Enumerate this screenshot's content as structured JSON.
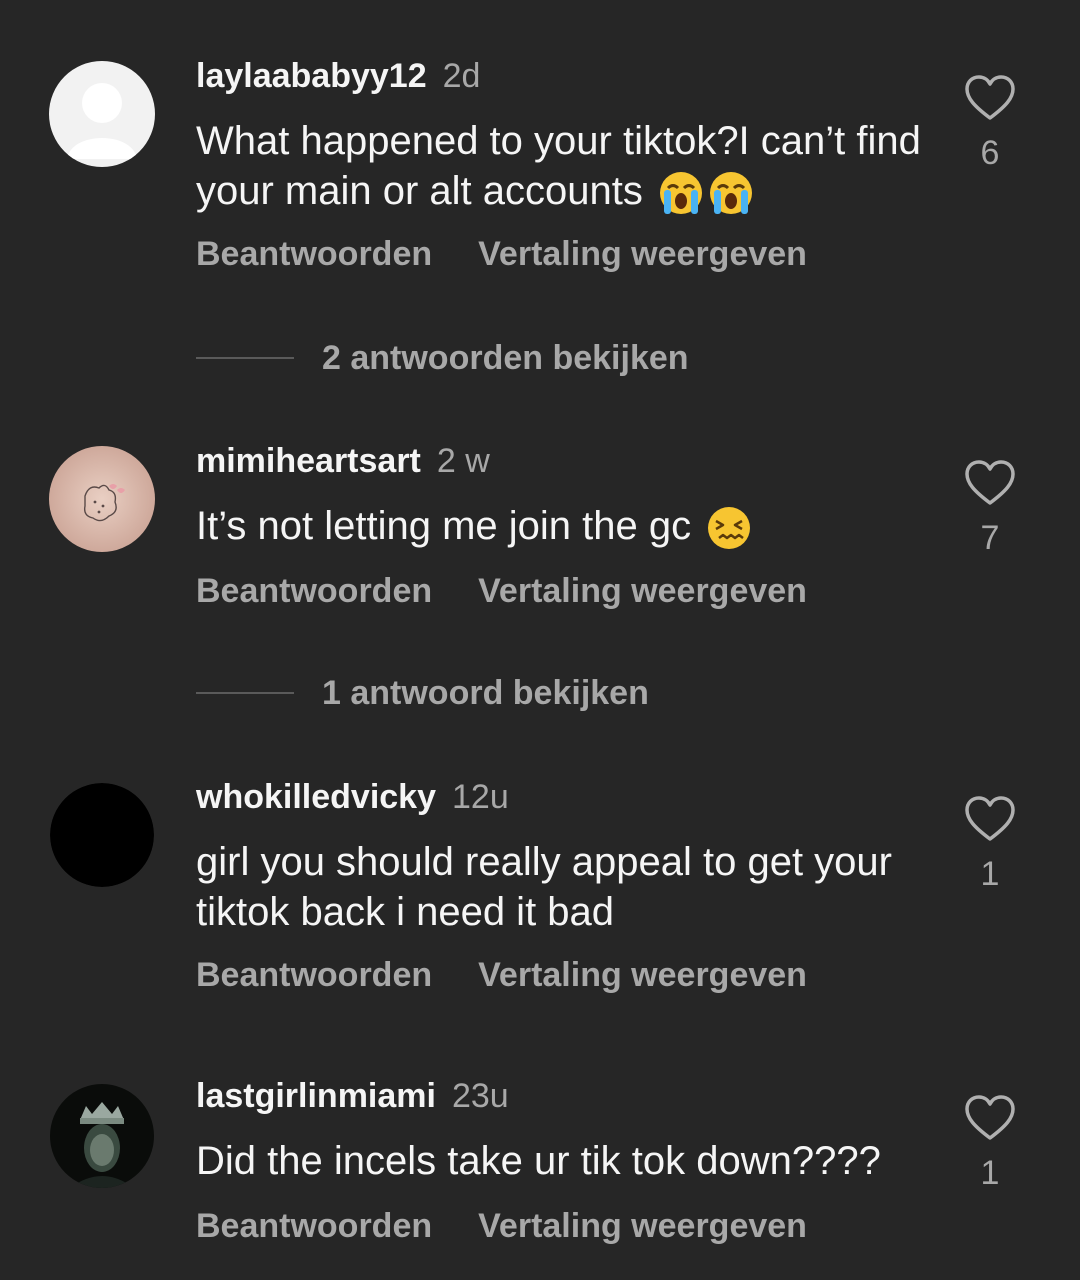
{
  "comments": [
    {
      "username": "laylaababyy12",
      "time": "2d",
      "text": "What happened to your tiktok?I can’t find your main or alt accounts",
      "emoji_icons": [
        "loudly-crying-face-icon",
        "loudly-crying-face-icon"
      ],
      "likes": "6",
      "reply_label": "Beantwoorden",
      "translate_label": "Vertaling weergeven",
      "view_replies": "2 antwoorden bekijken",
      "avatar": "default-avatar-icon"
    },
    {
      "username": "mimiheartsart",
      "time": "2 w",
      "text": "It’s not letting me join the gc",
      "emoji_icons": [
        "confounded-face-icon"
      ],
      "likes": "7",
      "reply_label": "Beantwoorden",
      "translate_label": "Vertaling weergeven",
      "view_replies": "1 antwoord bekijken",
      "avatar": "tattoo-photo-avatar"
    },
    {
      "username": "whokilledvicky",
      "time": "12u",
      "text": "girl you should really appeal to get your tiktok back i need it bad",
      "likes": "1",
      "reply_label": "Beantwoorden",
      "translate_label": "Vertaling weergeven",
      "avatar": "black-avatar"
    },
    {
      "username": "lastgirlinmiami",
      "time": "23u",
      "text": "Did the incels take ur tik tok down????",
      "likes": "1",
      "reply_label": "Beantwoorden",
      "translate_label": "Vertaling weergeven",
      "avatar": "crowned-person-photo-avatar"
    }
  ],
  "colors": {
    "background": "#262626",
    "primary_text": "#f5f5f5",
    "secondary_text": "#a8a8a8"
  }
}
